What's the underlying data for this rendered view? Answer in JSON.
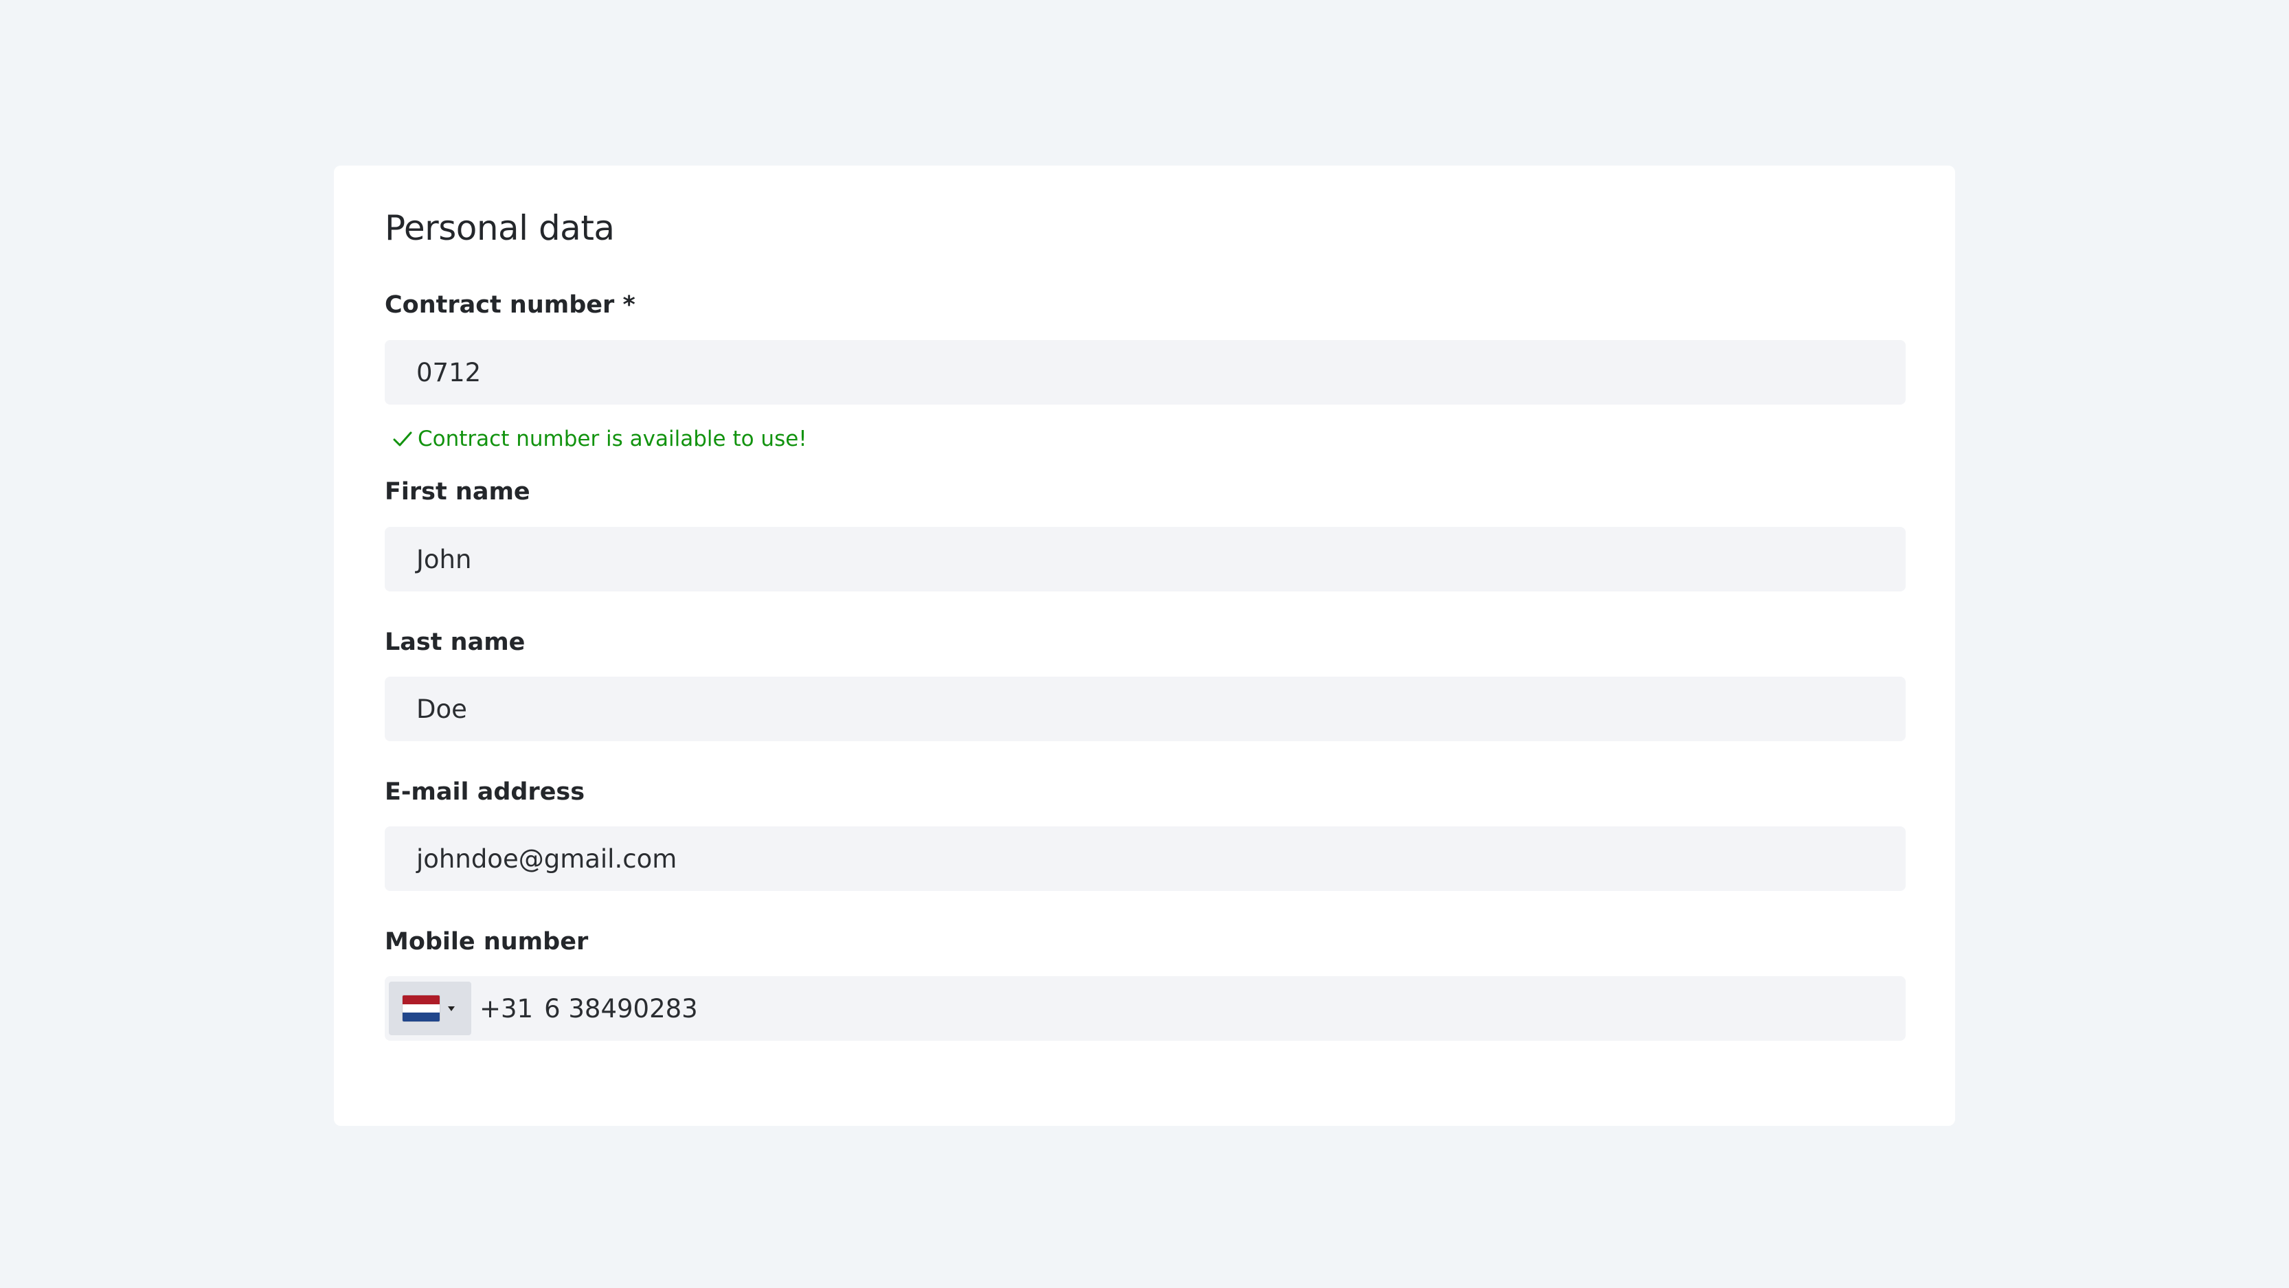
{
  "form": {
    "title": "Personal data",
    "contract": {
      "label": "Contract number *",
      "value": "0712",
      "status": "Contract number is available to use!"
    },
    "first_name": {
      "label": "First name",
      "value": "John"
    },
    "last_name": {
      "label": "Last name",
      "value": "Doe"
    },
    "email": {
      "label": "E-mail address",
      "value": "johndoe@gmail.com"
    },
    "mobile": {
      "label": "Mobile number",
      "country_flag": "netherlands-flag-icon",
      "dial_code": "+31",
      "value": "6 38490283"
    }
  },
  "colors": {
    "page_background": "#f2f5f8",
    "card_background": "#ffffff",
    "input_background": "#f3f4f7",
    "success": "#12930f",
    "flag_red": "#ae1c28",
    "flag_white": "#ffffff",
    "flag_blue": "#21468b"
  }
}
